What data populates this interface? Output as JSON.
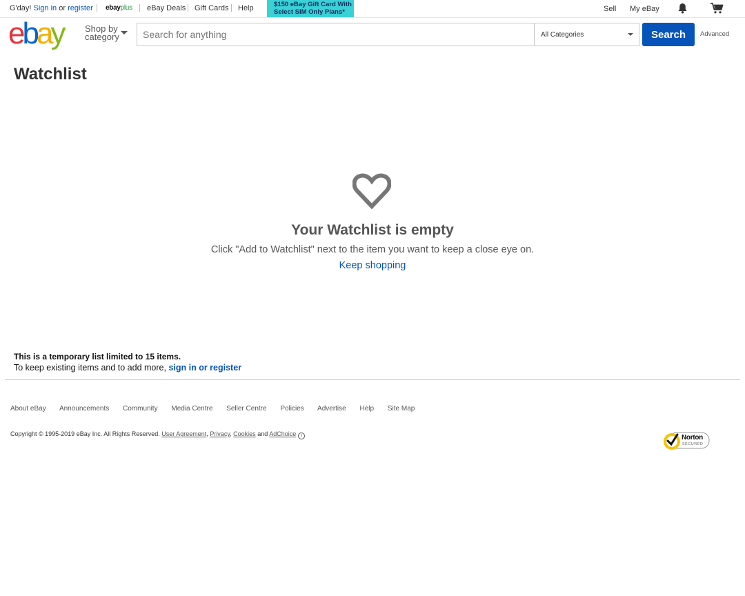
{
  "topbar": {
    "greeting": "G'day!",
    "sign_in": "Sign in",
    "or": "or",
    "register": "register",
    "ebayplus_brand": "ebay",
    "ebayplus_suffix": "plus",
    "deals": "eBay Deals",
    "gift_cards": "Gift Cards",
    "help": "Help",
    "promo_line1": "$150 eBay Gift Card With",
    "promo_line2": "Select SIM Only Plans*",
    "sell": "Sell",
    "my_ebay": "My eBay"
  },
  "header": {
    "logo": {
      "e": "e",
      "b": "b",
      "a": "a",
      "y": "y"
    },
    "shop_by_line1": "Shop by",
    "shop_by_line2": "category",
    "search_placeholder": "Search for anything",
    "category_selected": "All Categories",
    "search_button": "Search",
    "advanced": "Advanced"
  },
  "main": {
    "title": "Watchlist",
    "empty_title": "Your Watchlist is empty",
    "empty_sub": "Click \"Add to Watchlist\" next to the item you want to keep a close eye on.",
    "keep_shopping": "Keep shopping",
    "temp_note": "This is a temporary list limited to 15 items.",
    "temp_more": "To keep existing items and to add more,",
    "temp_link": "sign in or register"
  },
  "footer": {
    "links": [
      "About eBay",
      "Announcements",
      "Community",
      "Media Centre",
      "Seller Centre",
      "Policies",
      "Advertise",
      "Help",
      "Site Map"
    ],
    "copyright": "Copyright © 1995-2019 eBay Inc. All Rights Reserved.",
    "user_agreement": "User Agreement",
    "privacy": "Privacy",
    "cookies": "Cookies",
    "and": "and",
    "adchoice": "AdChoice",
    "norton_brand": "Norton",
    "norton_secured": "SECURED"
  },
  "colors": {
    "link_blue": "#0654ba",
    "promo_bg": "#3ad1d6",
    "logo_red": "#e53238",
    "logo_blue": "#0064d2",
    "logo_yellow": "#f5af02",
    "logo_green": "#86b817"
  }
}
